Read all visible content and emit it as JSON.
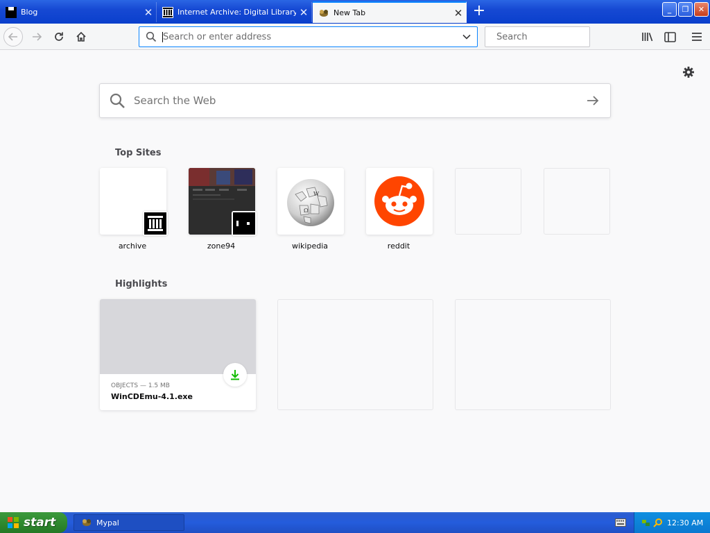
{
  "tabs": [
    {
      "title": "Blog",
      "active": false
    },
    {
      "title": "Internet Archive: Digital Library of",
      "active": false
    },
    {
      "title": "New Tab",
      "active": true
    }
  ],
  "navbar": {
    "url_placeholder": "Search or enter address",
    "search_placeholder": "Search"
  },
  "newtab": {
    "web_search_placeholder": "Search the Web",
    "top_sites_title": "Top Sites",
    "top_sites": [
      {
        "label": "archive"
      },
      {
        "label": "zone94"
      },
      {
        "label": "wikipedia"
      },
      {
        "label": "reddit"
      }
    ],
    "highlights_title": "Highlights",
    "highlight": {
      "meta": "OBJECTS — 1.5 MB",
      "name": "WinCDEmu-4.1.exe"
    }
  },
  "taskbar": {
    "start_label": "start",
    "window_label": "Mypal",
    "clock": "12:30 AM"
  },
  "colors": {
    "accent": "#0a84ff",
    "reddit": "#ff4500",
    "download": "#12bc00",
    "xp_blue": "#245cdc"
  }
}
